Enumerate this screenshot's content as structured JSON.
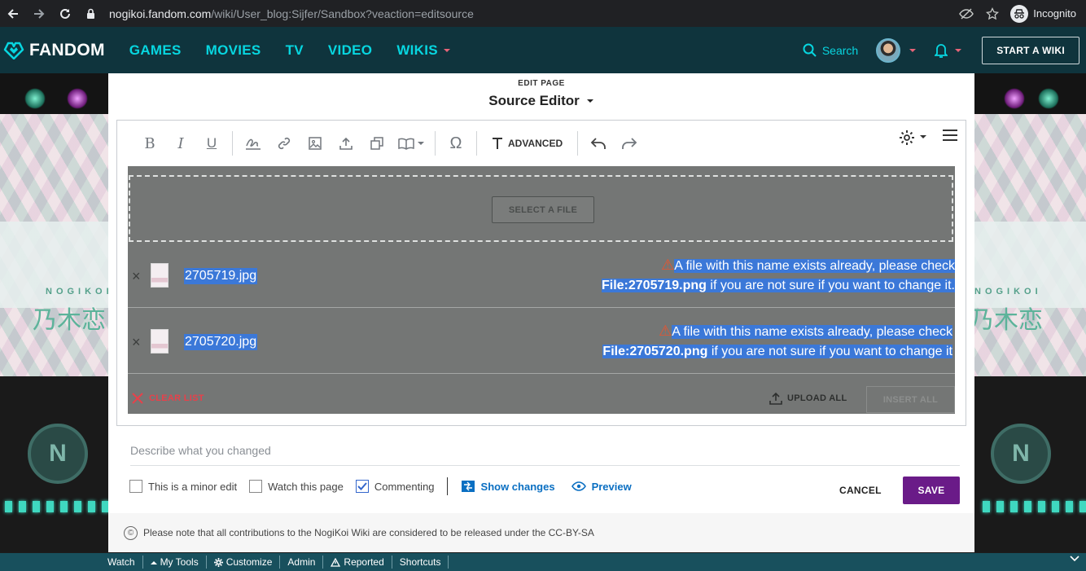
{
  "browser": {
    "url_host": "nogikoi.fandom.com",
    "url_path": "/wiki/User_blog:Sijfer/Sandbox?veaction=editsource",
    "profile_label": "Incognito"
  },
  "fandom_nav": {
    "logo_text": "FANDOM",
    "menu": [
      "GAMES",
      "MOVIES",
      "TV",
      "VIDEO",
      "WIKIS"
    ],
    "search_label": "Search",
    "start_wiki_label": "START A WIKI"
  },
  "side_brand": {
    "small": "NOGIKOI",
    "large": "乃木恋"
  },
  "editor_header": {
    "kicker": "EDIT PAGE",
    "title": "Source Editor"
  },
  "toolbar": {
    "advanced_label": "ADVANCED"
  },
  "upload": {
    "select_label": "SELECT A FILE",
    "files": [
      {
        "name": "2705719.jpg",
        "warning_line1": "A file with this name exists already, please check",
        "warning_link": "File:2705719.png",
        "warning_line2_rest": " if you are not sure if you want to change it."
      },
      {
        "name": "2705720.jpg",
        "warning_line1": "A file with this name exists already, please check",
        "warning_link": "File:2705720.png",
        "warning_line2_rest": " if you are not sure if you want to change it"
      }
    ],
    "clear_label": "CLEAR LIST",
    "upload_all_label": "UPLOAD ALL",
    "insert_all_label": "INSERT ALL"
  },
  "summary": {
    "placeholder": "Describe what you changed"
  },
  "options": {
    "minor_label": "This is a minor edit",
    "watch_label": "Watch this page",
    "commenting_label": "Commenting",
    "show_changes_label": "Show changes",
    "preview_label": "Preview",
    "cancel_label": "CANCEL",
    "save_label": "SAVE"
  },
  "notice": {
    "text": "Please note that all contributions to the NogiKoi Wiki are considered to be released under the CC-BY-SA"
  },
  "bottom_toolbar": [
    "Watch",
    "My Tools",
    "Customize",
    "Admin",
    "Reported",
    "Shortcuts"
  ],
  "colors": {
    "fandom_nav_bg": "#0f343d",
    "fandom_accent": "#07d6e0",
    "save_bg": "#6a1b88",
    "selection": "#3b78d8",
    "warning": "#e8552f"
  }
}
